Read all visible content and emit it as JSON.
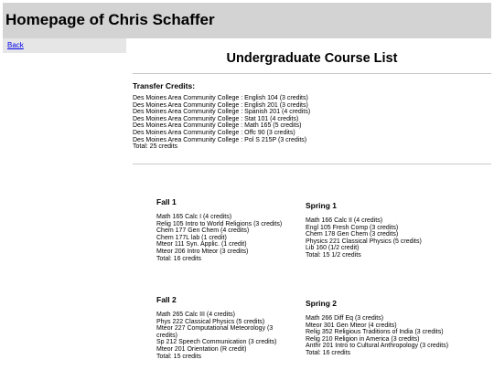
{
  "header": {
    "title": "Homepage of Chris Schaffer"
  },
  "sidebar": {
    "back_label": "Back"
  },
  "main": {
    "title": "Undergraduate Course List",
    "transfer": {
      "title": "Transfer Credits:",
      "items": [
        "Des Moines Area Community College : English 104 (3 credits)",
        "Des Moines Area Community College : English 201 (3 credits)",
        "Des Moines Area Community College : Spanish 201 (4 credits)",
        "Des Moines Area Community College : Stat 101 (4 credits)",
        "Des Moines Area Community College : Math 165 (5 credits)",
        "Des Moines Area Community College : Offc 90 (3 credits)",
        "Des Moines Area Community College : Pol S 215P (3 credits)"
      ],
      "total": "Total: 25 credits"
    },
    "terms": [
      {
        "title": "Fall 1",
        "items": [
          "Math 165 Calc I (4 credits)",
          "Relig 105 Intro to World Religions (3 credits)",
          "Chem 177 Gen Chem (4 credits)",
          "Chem 177L lab (1 credit)",
          "Mteor 111 Syn. Applic. (1 credit)",
          "Mteor 206 Intro Mteor (3 credits)"
        ],
        "total": "Total: 16 credits"
      },
      {
        "title": "Spring 1",
        "items": [
          "Math 166 Calc II (4 credits)",
          "Engl 105 Fresh Comp (3 credits)",
          "Chem 178 Gen Chem (3 credits)",
          "Physics 221 Classical Physics (5 credits)",
          "Lib 160 (1/2 credit)"
        ],
        "total": "Total: 15 1/2 credits"
      },
      {
        "title": "Fall 2",
        "items": [
          "Math 265 Calc III (4 credits)",
          "Phys 222 Classical Physics (5 credits)",
          "Mteor 227 Computational Meteorology (3",
          "credits)",
          "Sp 212 Speech Communication (3 credits)",
          "Mteor 201 Orientation (R credit)"
        ],
        "total": "Total: 15 credits"
      },
      {
        "title": "Spring 2",
        "items": [
          "Math 266 Diff Eq (3 credits)",
          "Mteor 301 Gen Mteor (4 credits)",
          "Relig 352 Religious Traditions of India (3 credits)",
          "Relig 210 Religion in America (3 credits)",
          "Anthr 201 Intro to Cultural Anthropology (3 credits)"
        ],
        "total": "Total: 16 credits"
      }
    ]
  }
}
